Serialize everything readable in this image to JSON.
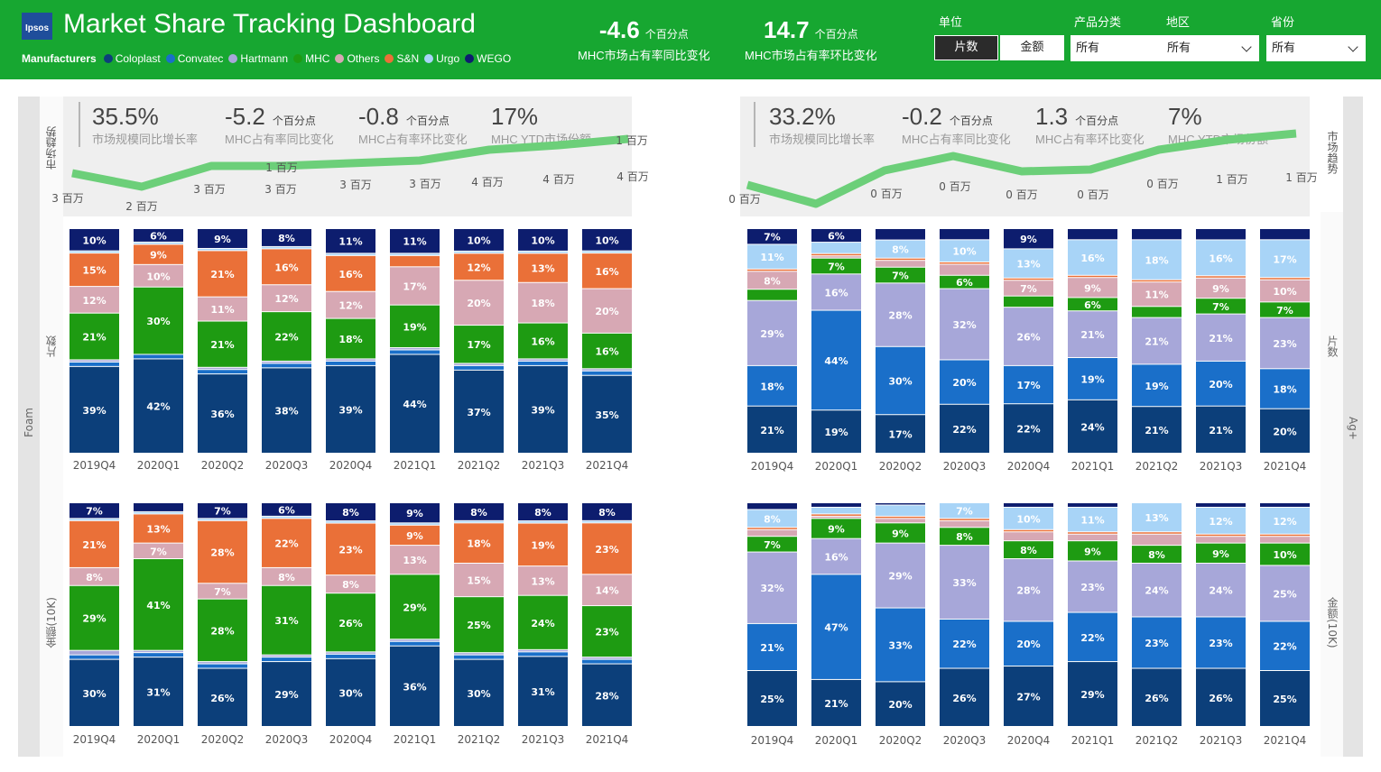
{
  "header": {
    "logo_text": "Ipsos",
    "title": "Market Share Tracking Dashboard",
    "manufacturers_label": "Manufacturers",
    "manufacturers": [
      {
        "name": "Coloplast",
        "color": "#0c3f7a"
      },
      {
        "name": "Convatec",
        "color": "#1a6fc9"
      },
      {
        "name": "Hartmann",
        "color": "#a7a7d9"
      },
      {
        "name": "MHC",
        "color": "#1e9b12"
      },
      {
        "name": "Others",
        "color": "#d7a8b4"
      },
      {
        "name": "S&N",
        "color": "#ea7038"
      },
      {
        "name": "Urgo",
        "color": "#a8d4f7"
      },
      {
        "name": "WEGO",
        "color": "#0d1d6e"
      }
    ],
    "kpis": [
      {
        "value": "-4.6",
        "unit": "个百分点",
        "label": "MHC市场占有率同比变化"
      },
      {
        "value": "14.7",
        "unit": "个百分点",
        "label": "MHC市场占有率环比变化"
      }
    ]
  },
  "filters": {
    "unit_label": "单位",
    "unit_options": [
      "片数",
      "金额"
    ],
    "unit_selected": "片数",
    "product_label": "产品分类",
    "product_value": "所有",
    "region_label": "地区",
    "region_value": "所有",
    "province_label": "省份",
    "province_value": "所有"
  },
  "rails": {
    "left": "Foam",
    "right": "Ag+"
  },
  "panels": [
    {
      "side": "left",
      "trend_label": "市场趋势",
      "stats": [
        {
          "value": "35.5%",
          "unit": "",
          "label": "市场规模同比增长率"
        },
        {
          "value": "-5.2",
          "unit": "个百分点",
          "label": "MHC占有率同比变化"
        },
        {
          "value": "-0.8",
          "unit": "个百分点",
          "label": "MHC占有率环比变化"
        },
        {
          "value": "17%",
          "unit": "",
          "label": "MHC YTD市场份额"
        }
      ],
      "trend_points": [
        "3 百万",
        "2 百万",
        "3 百万",
        "3 百万",
        "3 百万",
        "3 百万",
        "4 百万",
        "4 百万",
        "4 百万"
      ],
      "trend_extra": [
        "1 百万",
        "1 百万"
      ]
    },
    {
      "side": "right",
      "trend_label": "市场趋势",
      "stats": [
        {
          "value": "33.2%",
          "unit": "",
          "label": "市场规模同比增长率"
        },
        {
          "value": "-0.2",
          "unit": "个百分点",
          "label": "MHC占有率同比变化"
        },
        {
          "value": "1.3",
          "unit": "个百分点",
          "label": "MHC占有率环比变化"
        },
        {
          "value": "7%",
          "unit": "",
          "label": "MHC YTD市场份额"
        }
      ],
      "trend_points": [
        "0 百万",
        "",
        "0 百万",
        "0 百万",
        "0 百万",
        "0 百万",
        "0 百万",
        "1 百万",
        "1 百万"
      ],
      "trend_extra": []
    }
  ],
  "chart_data": [
    {
      "type": "bar",
      "id": "foam-pieces",
      "axis_label": "片数",
      "stacked": true,
      "percent": true,
      "categories": [
        "2019Q4",
        "2020Q1",
        "2020Q2",
        "2020Q3",
        "2020Q4",
        "2021Q1",
        "2021Q2",
        "2021Q3",
        "2021Q4"
      ],
      "series": [
        {
          "name": "Coloplast",
          "values": [
            39,
            42,
            36,
            38,
            39,
            44,
            37,
            39,
            35
          ]
        },
        {
          "name": "Convatec",
          "values": [
            2,
            2,
            2,
            2,
            2,
            2,
            2,
            2,
            2
          ]
        },
        {
          "name": "Hartmann",
          "values": [
            1,
            0,
            1,
            1,
            1,
            1,
            1,
            1,
            1
          ]
        },
        {
          "name": "MHC",
          "values": [
            21,
            30,
            21,
            22,
            18,
            19,
            17,
            16,
            16
          ]
        },
        {
          "name": "Others",
          "values": [
            12,
            10,
            11,
            12,
            12,
            17,
            20,
            18,
            20
          ]
        },
        {
          "name": "S&N",
          "values": [
            15,
            9,
            21,
            16,
            16,
            5,
            12,
            13,
            16
          ]
        },
        {
          "name": "Urgo",
          "values": [
            1,
            1,
            1,
            1,
            1,
            1,
            1,
            1,
            1
          ]
        },
        {
          "name": "WEGO",
          "values": [
            10,
            6,
            9,
            8,
            11,
            11,
            10,
            10,
            10
          ]
        }
      ]
    },
    {
      "type": "bar",
      "id": "foam-amount",
      "axis_label": "金额(10K)",
      "stacked": true,
      "percent": true,
      "categories": [
        "2019Q4",
        "2020Q1",
        "2020Q2",
        "2020Q3",
        "2020Q4",
        "2021Q1",
        "2021Q2",
        "2021Q3",
        "2021Q4"
      ],
      "series": [
        {
          "name": "Coloplast",
          "values": [
            30,
            31,
            26,
            29,
            30,
            36,
            30,
            31,
            28
          ]
        },
        {
          "name": "Convatec",
          "values": [
            2,
            2,
            2,
            2,
            2,
            2,
            2,
            2,
            2
          ]
        },
        {
          "name": "Hartmann",
          "values": [
            2,
            1,
            1,
            1,
            1,
            1,
            1,
            1,
            1
          ]
        },
        {
          "name": "MHC",
          "values": [
            29,
            41,
            28,
            31,
            26,
            29,
            25,
            24,
            23
          ]
        },
        {
          "name": "Others",
          "values": [
            8,
            7,
            7,
            8,
            8,
            13,
            15,
            13,
            14
          ]
        },
        {
          "name": "S&N",
          "values": [
            21,
            13,
            28,
            22,
            23,
            9,
            18,
            19,
            23
          ]
        },
        {
          "name": "Urgo",
          "values": [
            1,
            1,
            1,
            1,
            1,
            1,
            1,
            1,
            1
          ]
        },
        {
          "name": "WEGO",
          "values": [
            7,
            4,
            7,
            6,
            8,
            9,
            8,
            8,
            8
          ]
        }
      ]
    },
    {
      "type": "bar",
      "id": "ag-pieces",
      "axis_label": "片数",
      "stacked": true,
      "percent": true,
      "categories": [
        "2019Q4",
        "2020Q1",
        "2020Q2",
        "2020Q3",
        "2020Q4",
        "2021Q1",
        "2021Q2",
        "2021Q3",
        "2021Q4"
      ],
      "series": [
        {
          "name": "Coloplast",
          "values": [
            21,
            19,
            17,
            22,
            22,
            24,
            21,
            21,
            20
          ]
        },
        {
          "name": "Convatec",
          "values": [
            18,
            44,
            30,
            20,
            17,
            19,
            19,
            20,
            18
          ]
        },
        {
          "name": "Hartmann",
          "values": [
            29,
            16,
            28,
            32,
            26,
            21,
            21,
            21,
            23
          ]
        },
        {
          "name": "MHC",
          "values": [
            5,
            7,
            7,
            6,
            5,
            6,
            5,
            7,
            7
          ]
        },
        {
          "name": "Others",
          "values": [
            8,
            1,
            3,
            5,
            7,
            9,
            11,
            9,
            10
          ]
        },
        {
          "name": "S&N",
          "values": [
            1,
            1,
            1,
            1,
            1,
            1,
            1,
            1,
            1
          ]
        },
        {
          "name": "Urgo",
          "values": [
            11,
            5,
            8,
            10,
            13,
            16,
            18,
            16,
            17
          ]
        },
        {
          "name": "WEGO",
          "values": [
            7,
            6,
            5,
            5,
            9,
            5,
            5,
            5,
            5
          ]
        }
      ]
    },
    {
      "type": "bar",
      "id": "ag-amount",
      "axis_label": "金额(10K)",
      "stacked": true,
      "percent": true,
      "categories": [
        "2019Q4",
        "2020Q1",
        "2020Q2",
        "2020Q3",
        "2020Q4",
        "2021Q1",
        "2021Q2",
        "2021Q3",
        "2021Q4"
      ],
      "series": [
        {
          "name": "Coloplast",
          "values": [
            25,
            21,
            20,
            26,
            27,
            29,
            26,
            26,
            25
          ]
        },
        {
          "name": "Convatec",
          "values": [
            21,
            47,
            33,
            22,
            20,
            22,
            23,
            23,
            22
          ]
        },
        {
          "name": "Hartmann",
          "values": [
            32,
            16,
            29,
            33,
            28,
            23,
            24,
            24,
            25
          ]
        },
        {
          "name": "MHC",
          "values": [
            7,
            9,
            9,
            8,
            8,
            9,
            8,
            9,
            10
          ]
        },
        {
          "name": "Others",
          "values": [
            3,
            1,
            2,
            3,
            4,
            3,
            5,
            3,
            3
          ]
        },
        {
          "name": "S&N",
          "values": [
            1,
            1,
            1,
            1,
            1,
            1,
            1,
            1,
            1
          ]
        },
        {
          "name": "Urgo",
          "values": [
            8,
            3,
            5,
            7,
            10,
            11,
            13,
            12,
            12
          ]
        },
        {
          "name": "WEGO",
          "values": [
            3,
            2,
            1,
            0,
            2,
            2,
            0,
            2,
            2
          ]
        }
      ]
    }
  ]
}
